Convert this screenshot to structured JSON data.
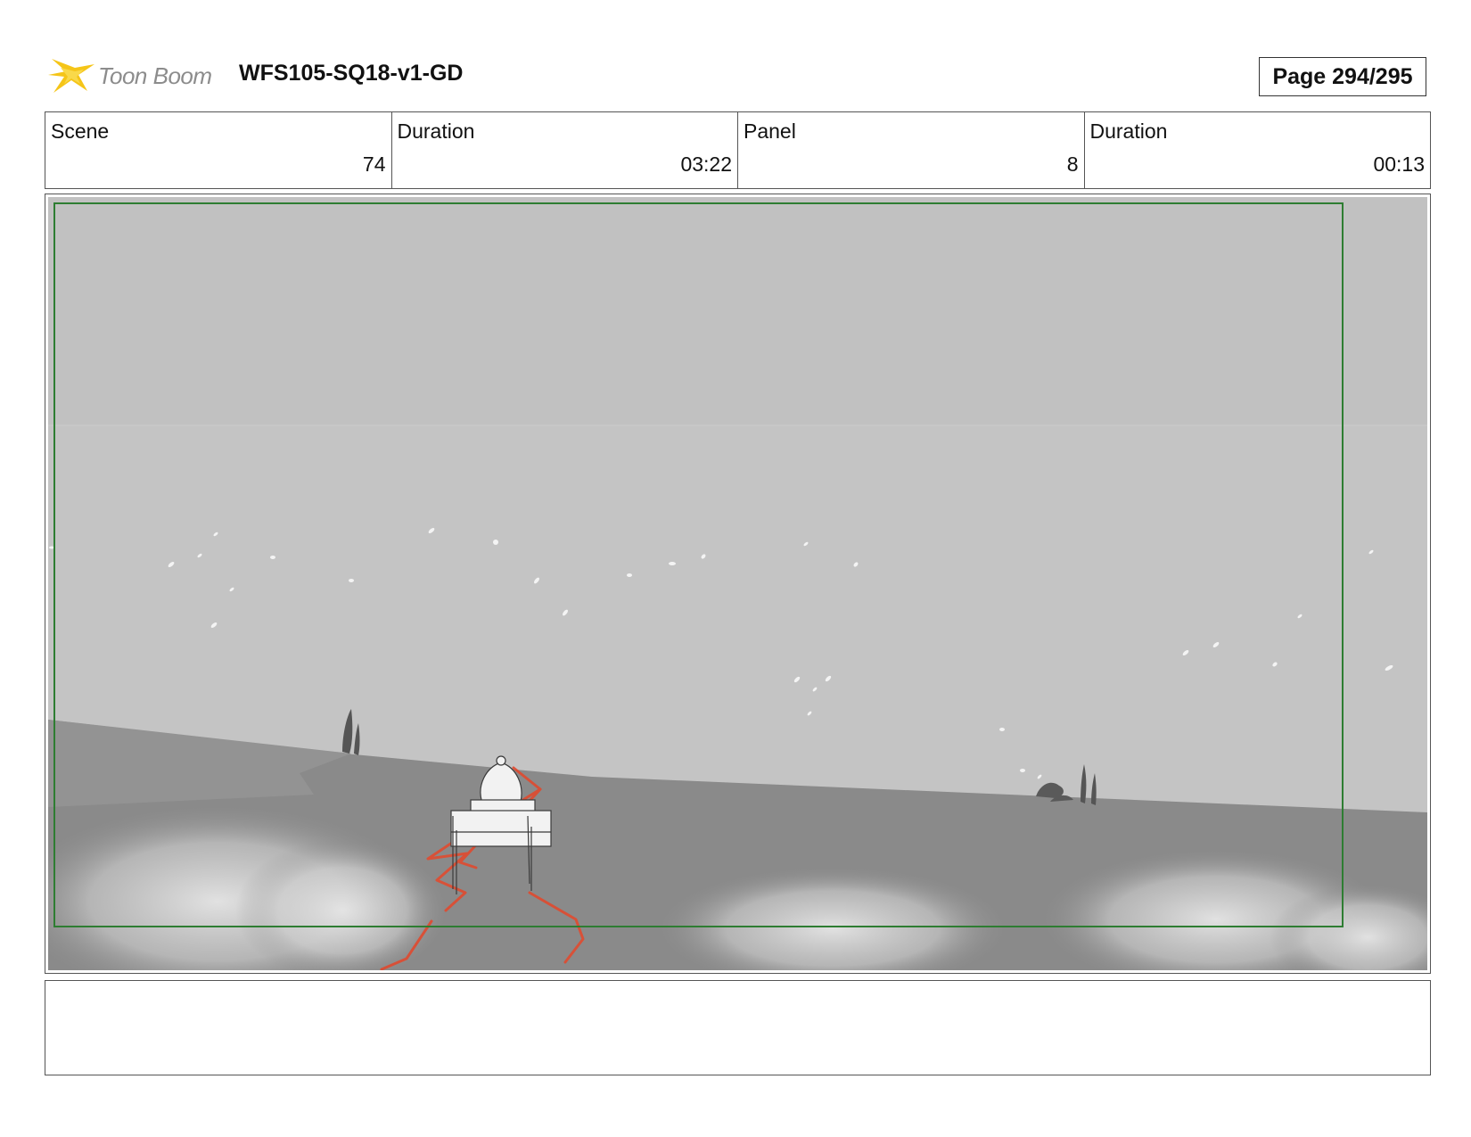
{
  "header": {
    "logo_text": "Toon Boom",
    "project_title": "WFS105-SQ18-v1-GD",
    "page_label": "Page 294/295"
  },
  "info": {
    "scene_label": "Scene",
    "scene_value": "74",
    "scene_duration_label": "Duration",
    "scene_duration_value": "03:22",
    "panel_label": "Panel",
    "panel_value": "8",
    "panel_duration_label": "Duration",
    "panel_duration_value": "00:13"
  },
  "colors": {
    "sky": "#c4c4c4",
    "ground": "#8a8a8a",
    "safe_frame": "#2e7d32",
    "path_accent": "#e04a2f",
    "logo_star": "#f5c518"
  },
  "icons": {
    "logo": "toon-boom-star-icon"
  },
  "notes": ""
}
